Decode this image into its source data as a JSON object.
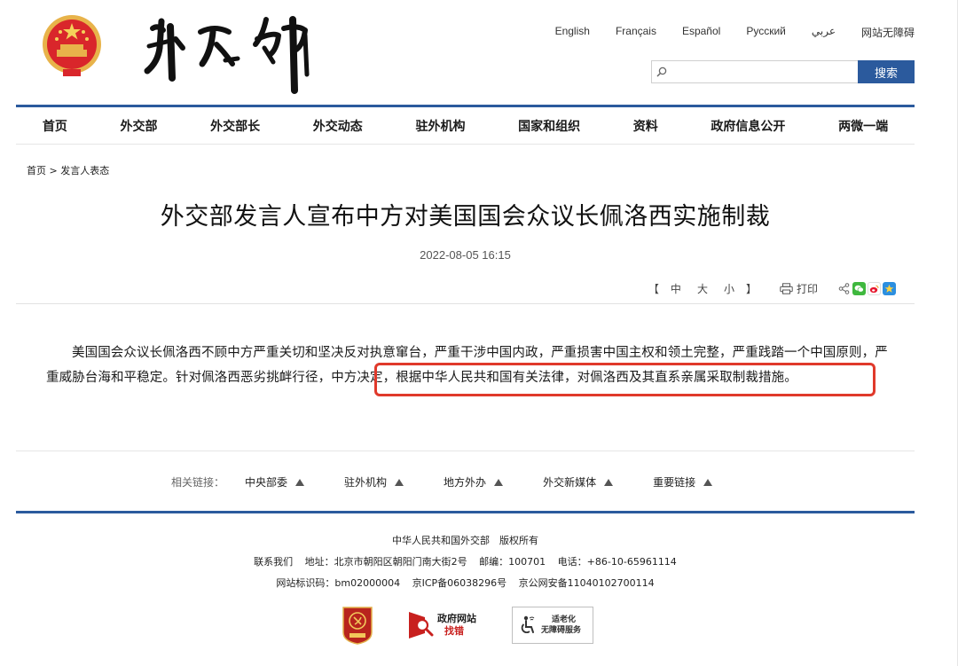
{
  "header": {
    "languages": [
      "English",
      "Français",
      "Español",
      "Русский",
      "عربي",
      "网站无障碍"
    ],
    "search": {
      "value": "",
      "placeholder": "",
      "button_label": "搜索",
      "icon": "search-icon"
    },
    "emblem_icon": "national-emblem-icon",
    "logo_icon": "ministry-calligraphy-logo"
  },
  "nav": {
    "items": [
      "首页",
      "外交部",
      "外交部长",
      "外交动态",
      "驻外机构",
      "国家和组织",
      "资料",
      "政府信息公开",
      "两微一端"
    ]
  },
  "breadcrumb": {
    "home": "首页",
    "separator": ">",
    "current": "发言人表态"
  },
  "article": {
    "title": "外交部发言人宣布中方对美国国会众议长佩洛西实施制裁",
    "date": "2022-08-05 16:15",
    "body_part1": "美国国会众议长佩洛西不顾中方严重关切和坚决反对执意窜台，严重干涉中国内政，严重损害中国主权和领土完整，严重践踏一个中国原则，严重威胁台海和平稳定。针对佩洛西恶劣挑衅行径，",
    "body_part2": "中方决定，根据中华人民共和国有关法律，对佩洛西及其直系亲属采取制裁措施。"
  },
  "tools": {
    "fontsize_open": "【",
    "fontsize_labels": [
      "中",
      "大",
      "小"
    ],
    "fontsize_close": "】",
    "print_label": "打印",
    "share_icons": [
      "share-icon",
      "wechat-icon",
      "weibo-icon",
      "qzone-icon"
    ]
  },
  "related": {
    "label": "相关链接：",
    "items": [
      "中央部委",
      "驻外机构",
      "地方外办",
      "外交新媒体",
      "重要链接"
    ]
  },
  "footer": {
    "copyright": "中华人民共和国外交部　版权所有",
    "contact": "联系我们",
    "address": "地址：北京市朝阳区朝阳门南大街2号",
    "postcode": "邮编：100701",
    "phone": "电话：+86-10-65961114",
    "site_id": "网站标识码：bm02000004",
    "icp": "京ICP备06038296号",
    "police": "京公网安备11040102700114",
    "badges": {
      "gov_line1": "政府网站",
      "gov_line2": "找错",
      "access_line1": "适老化",
      "access_line2": "无障碍服务"
    }
  },
  "colors": {
    "brand_blue": "#2b5a9d",
    "highlight_red": "#e0392b"
  }
}
